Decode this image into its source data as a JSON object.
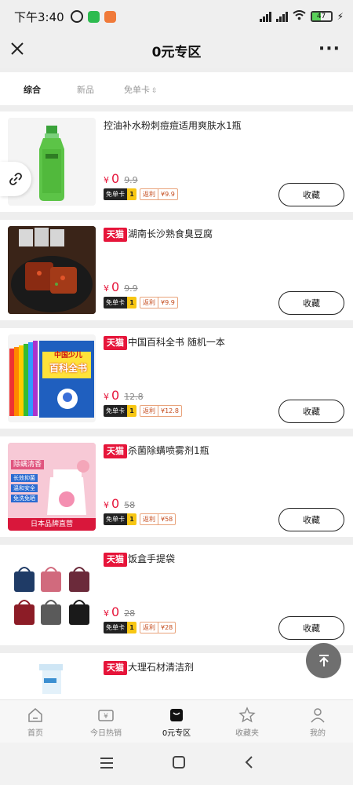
{
  "status": {
    "time": "下午3:40",
    "battery": "47"
  },
  "header": {
    "title": "0元专区"
  },
  "filters": [
    {
      "label": "综合",
      "active": true
    },
    {
      "label": "新品",
      "active": false
    },
    {
      "label": "免单卡",
      "active": false
    }
  ],
  "products": [
    {
      "title": "控油补水粉刺痘痘适用爽肤水1瓶",
      "tmall": false,
      "currency": "¥",
      "price": "0",
      "original": "9.9",
      "card_label": "免单卡",
      "card_count": "1",
      "rebate_label": "返利",
      "rebate_amount": "¥9.9",
      "button": "收藏"
    },
    {
      "title": "湖南长沙熟食臭豆腐",
      "tmall": true,
      "tmall_label": "天猫",
      "currency": "¥",
      "price": "0",
      "original": "9.9",
      "card_label": "免单卡",
      "card_count": "1",
      "rebate_label": "返利",
      "rebate_amount": "¥9.9",
      "button": "收藏"
    },
    {
      "title": "中国百科全书 随机一本",
      "tmall": true,
      "tmall_label": "天猫",
      "currency": "¥",
      "price": "0",
      "original": "12.8",
      "card_label": "免单卡",
      "card_count": "1",
      "rebate_label": "返利",
      "rebate_amount": "¥12.8",
      "button": "收藏"
    },
    {
      "title": "杀菌除螨喷雾剂1瓶",
      "tmall": true,
      "tmall_label": "天猫",
      "currency": "¥",
      "price": "0",
      "original": "58",
      "card_label": "免单卡",
      "card_count": "1",
      "rebate_label": "返利",
      "rebate_amount": "¥58",
      "button": "收藏"
    },
    {
      "title": "饭盒手提袋",
      "tmall": true,
      "tmall_label": "天猫",
      "currency": "¥",
      "price": "0",
      "original": "28",
      "card_label": "免单卡",
      "card_count": "1",
      "rebate_label": "返利",
      "rebate_amount": "¥28",
      "button": "收藏"
    },
    {
      "title": "大理石材清洁剂",
      "tmall": true,
      "tmall_label": "天猫"
    }
  ],
  "thumb_text": {
    "book_title_1": "中国少儿",
    "book_title_2": "百科全书",
    "spray_brand": "日本品牌直营",
    "spray_title": "除螨清香",
    "spray_bullets": [
      "长效抑菌",
      "温和安全",
      "免洗免晒"
    ]
  },
  "tabs": [
    {
      "label": "首页",
      "icon": "home-icon"
    },
    {
      "label": "今日热销",
      "icon": "ticket-icon"
    },
    {
      "label": "0元专区",
      "icon": "free-zone-icon",
      "active": true
    },
    {
      "label": "收藏夹",
      "icon": "star-icon"
    },
    {
      "label": "我的",
      "icon": "user-icon"
    }
  ],
  "colors": {
    "accent": "#e6153a",
    "tmall": "#e6153a",
    "card_tag_bg": "#222222",
    "card_count_bg": "#f7c613"
  }
}
